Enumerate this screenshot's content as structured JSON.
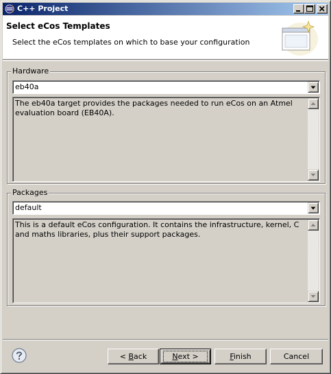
{
  "window": {
    "title": "C++ Project",
    "controls": {
      "minimize": "minimize",
      "maximize": "maximize",
      "close": "close"
    }
  },
  "header": {
    "title": "Select eCos Templates",
    "description": "Select the eCos templates on which to base your configuration",
    "art_icon": "wizard-banner-icon"
  },
  "hardware": {
    "label": "Hardware",
    "selected": "eb40a",
    "description": "The eb40a target provides the packages needed to run eCos on an Atmel evaluation board (EB40A)."
  },
  "packages": {
    "label": "Packages",
    "selected": "default",
    "description": "This is a default eCos configuration. It contains the infrastructure, kernel, C and maths libraries, plus their support packages."
  },
  "footer": {
    "help_icon": "help-icon",
    "back": {
      "prefix": "< ",
      "mnemonic": "B",
      "rest": "ack"
    },
    "next": {
      "mnemonic": "N",
      "rest": "ext >"
    },
    "finish": {
      "mnemonic": "F",
      "rest": "inish"
    },
    "cancel": "Cancel"
  },
  "colors": {
    "face": "#d4d0c8",
    "titlebar_start": "#0a246a",
    "titlebar_end": "#a6caf0",
    "banner_bg": "#ffffff"
  }
}
